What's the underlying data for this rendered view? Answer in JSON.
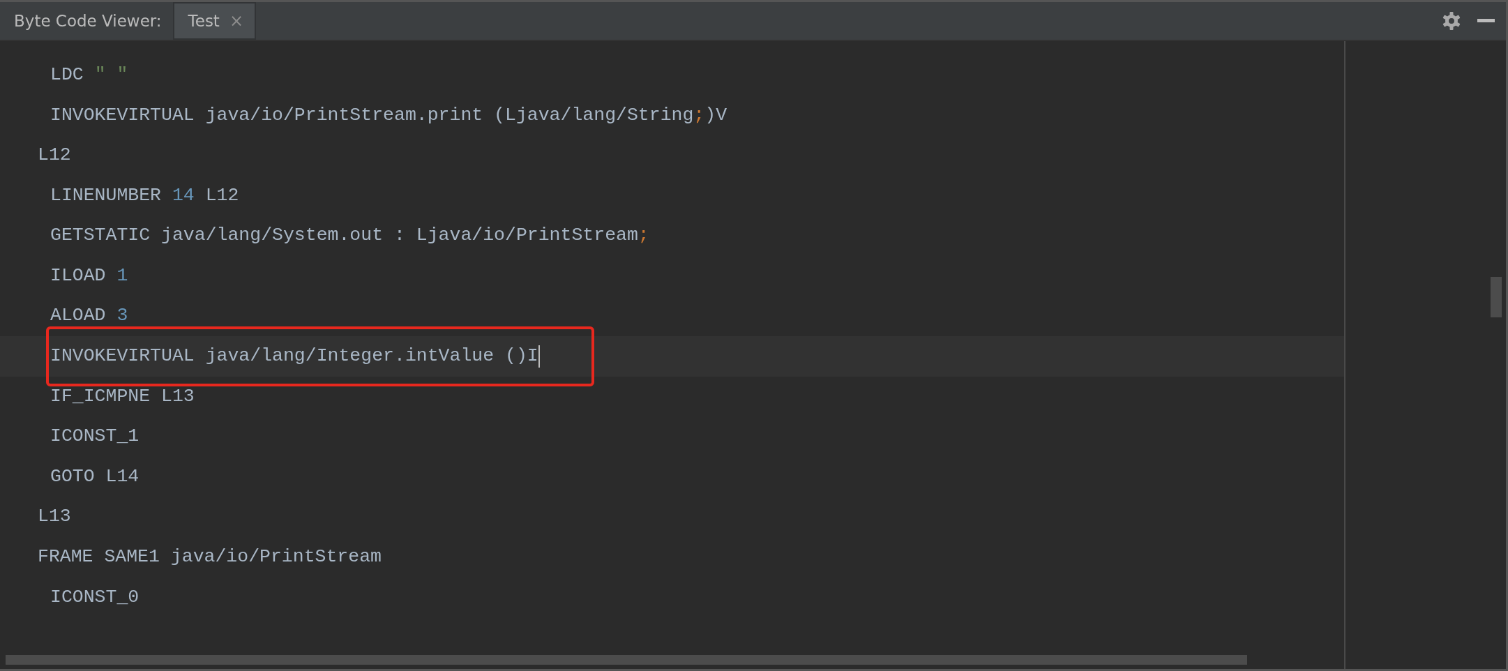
{
  "panel": {
    "title": "Byte Code Viewer:"
  },
  "tabs": [
    {
      "label": "Test",
      "close": "×",
      "selected": true
    }
  ],
  "lines": [
    {
      "kind": "instruction",
      "current": false,
      "annotated": false,
      "tokens": [
        {
          "text": "LDC ",
          "kind": "plain"
        },
        {
          "text": "\" \"",
          "kind": "string"
        }
      ]
    },
    {
      "kind": "instruction",
      "current": false,
      "annotated": false,
      "tokens": [
        {
          "text": "INVOKEVIRTUAL java/io/PrintStream.print (Ljava/lang/String",
          "kind": "plain"
        },
        {
          "text": ";",
          "kind": "punct"
        },
        {
          "text": ")V",
          "kind": "plain"
        }
      ]
    },
    {
      "kind": "label",
      "current": false,
      "annotated": false,
      "tokens": [
        {
          "text": "L12",
          "kind": "plain"
        }
      ]
    },
    {
      "kind": "instruction",
      "current": false,
      "annotated": false,
      "tokens": [
        {
          "text": "LINENUMBER ",
          "kind": "plain"
        },
        {
          "text": "14",
          "kind": "number"
        },
        {
          "text": " L12",
          "kind": "plain"
        }
      ]
    },
    {
      "kind": "instruction",
      "current": false,
      "annotated": false,
      "tokens": [
        {
          "text": "GETSTATIC java/lang/System.out : Ljava/io/PrintStream",
          "kind": "plain"
        },
        {
          "text": ";",
          "kind": "punct"
        }
      ]
    },
    {
      "kind": "instruction",
      "current": false,
      "annotated": false,
      "tokens": [
        {
          "text": "ILOAD ",
          "kind": "plain"
        },
        {
          "text": "1",
          "kind": "number"
        }
      ]
    },
    {
      "kind": "instruction",
      "current": false,
      "annotated": false,
      "tokens": [
        {
          "text": "ALOAD ",
          "kind": "plain"
        },
        {
          "text": "3",
          "kind": "number"
        }
      ]
    },
    {
      "kind": "instruction",
      "current": true,
      "annotated": true,
      "tokens": [
        {
          "text": "INVOKEVIRTUAL java/lang/Integer.intValue ()I",
          "kind": "plain"
        }
      ]
    },
    {
      "kind": "instruction",
      "current": false,
      "annotated": false,
      "tokens": [
        {
          "text": "IF_ICMPNE L13",
          "kind": "plain"
        }
      ]
    },
    {
      "kind": "instruction",
      "current": false,
      "annotated": false,
      "tokens": [
        {
          "text": "ICONST_1",
          "kind": "plain"
        }
      ]
    },
    {
      "kind": "instruction",
      "current": false,
      "annotated": false,
      "tokens": [
        {
          "text": "GOTO L14",
          "kind": "plain"
        }
      ]
    },
    {
      "kind": "label",
      "current": false,
      "annotated": false,
      "tokens": [
        {
          "text": "L13",
          "kind": "plain"
        }
      ]
    },
    {
      "kind": "label",
      "current": false,
      "annotated": false,
      "tokens": [
        {
          "text": "FRAME SAME1 java/io/PrintStream",
          "kind": "plain"
        }
      ]
    },
    {
      "kind": "instruction",
      "current": false,
      "annotated": false,
      "tokens": [
        {
          "text": "ICONST_0",
          "kind": "plain"
        }
      ]
    }
  ]
}
